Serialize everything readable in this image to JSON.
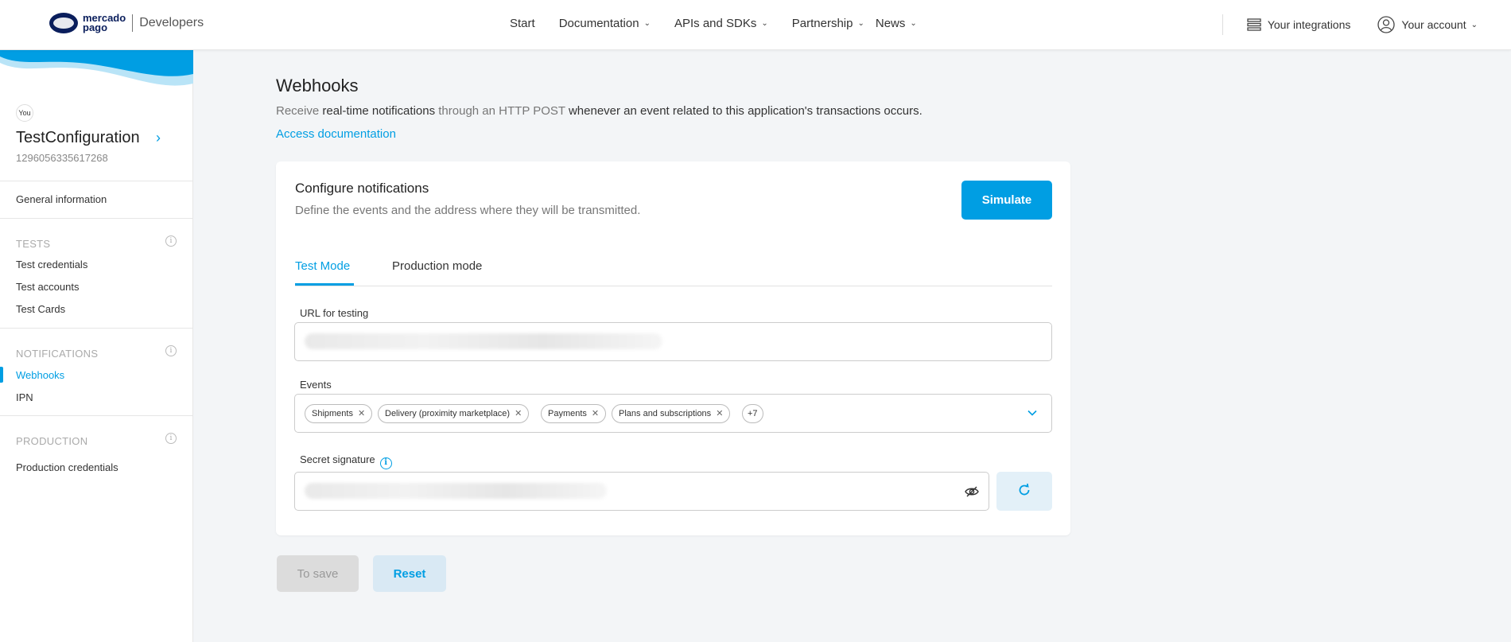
{
  "brand": {
    "logo_line1": "mercado",
    "logo_line2": "pago",
    "product": "Developers"
  },
  "nav": {
    "start": "Start",
    "documentation": "Documentation",
    "apis": "APIs and SDKs",
    "partnership": "Partnership",
    "news": "News",
    "integrations": "Your integrations",
    "account": "Your account"
  },
  "sidebar": {
    "you": "You",
    "app_name": "TestConfiguration",
    "app_id": "1296056335617268",
    "general": "General information",
    "tests_title": "TESTS",
    "tests": [
      "Test credentials",
      "Test accounts",
      "Test Cards"
    ],
    "notifications_title": "NOTIFICATIONS",
    "notifications": [
      "Webhooks",
      "IPN"
    ],
    "production_title": "PRODUCTION",
    "production": [
      "Production credentials"
    ]
  },
  "main": {
    "title": "Webhooks",
    "desc_1": "Receive ",
    "desc_2": "real-time notifications",
    "desc_3": " through an HTTP POST ",
    "desc_4": "whenever an event related to this application's transactions occurs.",
    "doc_link": "Access documentation"
  },
  "card": {
    "title": "Configure notifications",
    "subtitle": "Define the events and the address where they will be transmitted.",
    "simulate": "Simulate",
    "tabs": [
      "Test Mode",
      "Production mode"
    ],
    "url_label": "URL for testing",
    "events_label": "Events",
    "events": [
      "Shipments",
      "Delivery (proximity marketplace)",
      "Payments",
      "Plans and subscriptions"
    ],
    "events_more": "+7",
    "secret_label": "Secret signature"
  },
  "actions": {
    "save": "To save",
    "reset": "Reset"
  },
  "colors": {
    "accent": "#009ee3",
    "brand_dark": "#0a1e5c"
  }
}
